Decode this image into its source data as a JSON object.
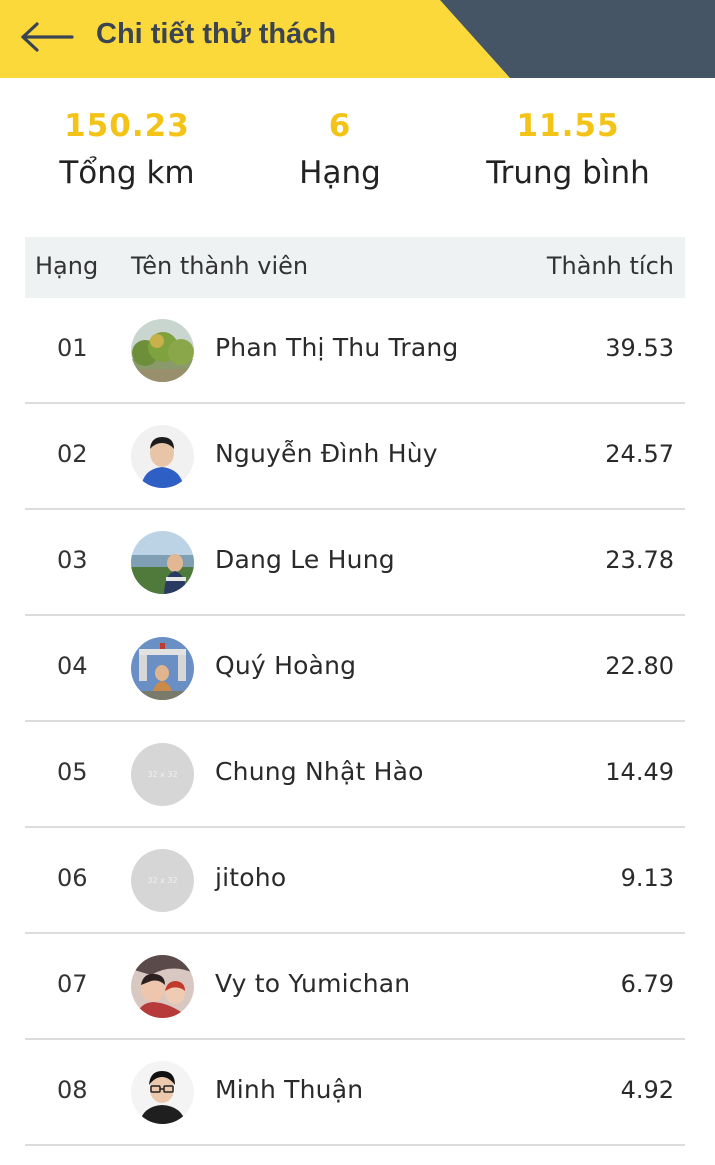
{
  "header": {
    "title": "Chi tiết thử thách",
    "back_icon": "arrow-left-icon",
    "colors": {
      "yellow": "#fcd93a",
      "slate": "#455566"
    }
  },
  "stats": [
    {
      "value": "150.23",
      "label": "Tổng km"
    },
    {
      "value": "6",
      "label": "Hạng"
    },
    {
      "value": "11.55",
      "label": "Trung bình"
    }
  ],
  "table": {
    "headers": {
      "rank": "Hạng",
      "name": "Tên thành viên",
      "score": "Thành tích"
    },
    "rows": [
      {
        "rank": "01",
        "name": "Phan Thị Thu Trang",
        "score": "39.53",
        "avatar": "photo-trees"
      },
      {
        "rank": "02",
        "name": "Nguyễn Đình Hùy",
        "score": "24.57",
        "avatar": "photo-person-blue"
      },
      {
        "rank": "03",
        "name": "Dang Le Hung",
        "score": "23.78",
        "avatar": "photo-lake"
      },
      {
        "rank": "04",
        "name": "Quý Hoàng",
        "score": "22.80",
        "avatar": "photo-monument"
      },
      {
        "rank": "05",
        "name": "Chung Nhật Hào",
        "score": "14.49",
        "avatar": "placeholder",
        "avatar_text": "32 x 32"
      },
      {
        "rank": "06",
        "name": "jitoho",
        "score": "9.13",
        "avatar": "placeholder",
        "avatar_text": "32 x 32"
      },
      {
        "rank": "07",
        "name": "Vy to Yumichan",
        "score": "6.79",
        "avatar": "photo-two-people"
      },
      {
        "rank": "08",
        "name": "Minh Thuận",
        "score": "4.92",
        "avatar": "photo-person-glasses"
      }
    ]
  }
}
